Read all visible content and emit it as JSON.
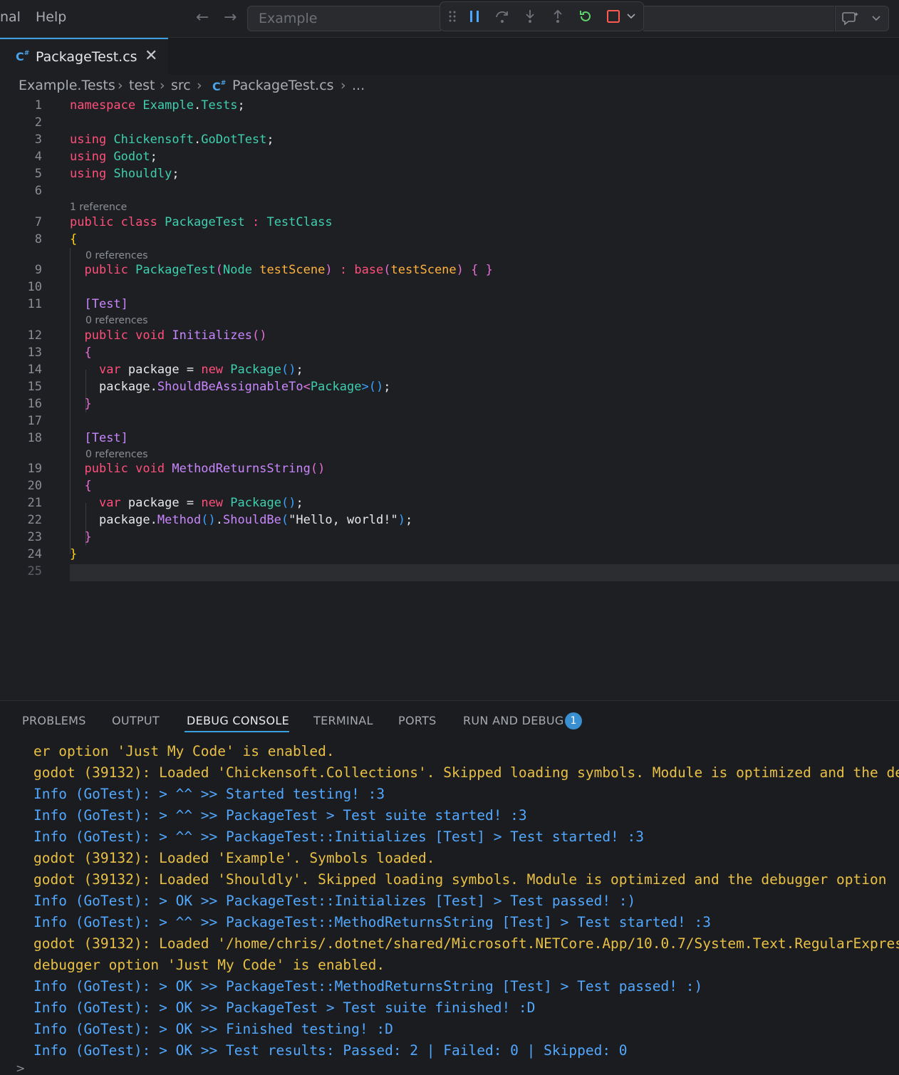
{
  "titlebar": {
    "menu_partial": "nal",
    "menu_help": "Help",
    "back": "←",
    "forward": "→",
    "command_center": "Example"
  },
  "tab": {
    "label": "PackageTest.cs",
    "close": "✕",
    "lang_icon": "C#"
  },
  "breadcrumb": [
    "Example.Tests",
    "test",
    "src",
    "PackageTest.cs",
    "..."
  ],
  "editor": {
    "line_numbers": [
      "1",
      "2",
      "3",
      "4",
      "5",
      "6",
      "7",
      "8",
      "9",
      "10",
      "11",
      "12",
      "13",
      "14",
      "15",
      "16",
      "17",
      "18",
      "19",
      "20",
      "21",
      "22",
      "23",
      "24",
      "25"
    ],
    "codelens": {
      "l7": "1 reference",
      "l9": "0 references",
      "l12": "0 references",
      "l19": "0 references"
    },
    "tokens": {
      "namespace": "namespace",
      "ns_example": "Example",
      "dot": ".",
      "ns_tests": "Tests",
      "semi": ";",
      "using": "using",
      "chickensoft": "Chickensoft",
      "godottest": "GoDotTest",
      "godot": "Godot",
      "shouldly": "Shouldly",
      "public": "public",
      "class": "class",
      "packagetest": "PackageTest",
      "colon": ":",
      "testclass": "TestClass",
      "lbrace": "{",
      "rbrace": "}",
      "lparen": "(",
      "rparen": ")",
      "node": "Node",
      "testscene": "testScene",
      "base": "base",
      "attr_test": "[Test]",
      "void": "void",
      "initializes": "Initializes",
      "parens": "()",
      "var": "var",
      "package": "package",
      "eq": "=",
      "new": "new",
      "package_type": "Package",
      "should_assignable": "ShouldBeAssignableTo",
      "lt": "<",
      "gt": ">",
      "method_returns_string": "MethodReturnsString",
      "method": "Method",
      "shouldbe": "ShouldBe",
      "hello": "\"Hello, world!\""
    }
  },
  "panel": {
    "tabs": [
      "PROBLEMS",
      "OUTPUT",
      "DEBUG CONSOLE",
      "TERMINAL",
      "PORTS",
      "RUN AND DEBUG"
    ],
    "active_tab": "DEBUG CONSOLE",
    "run_debug_badge": "1",
    "console_lines": [
      {
        "kind": "warn",
        "text": "er option 'Just My Code' is enabled."
      },
      {
        "kind": "warn",
        "text": "godot (39132): Loaded 'Chickensoft.Collections'. Skipped loading symbols. Module is optimized and the de"
      },
      {
        "kind": "info",
        "text": "Info (GoTest): > ^^ >> Started testing! :3"
      },
      {
        "kind": "info",
        "text": "Info (GoTest): > ^^ >> PackageTest > Test suite started! :3"
      },
      {
        "kind": "info",
        "text": "Info (GoTest): > ^^ >> PackageTest::Initializes [Test] > Test started! :3"
      },
      {
        "kind": "warn",
        "text": "godot (39132): Loaded 'Example'. Symbols loaded."
      },
      {
        "kind": "warn",
        "text": "godot (39132): Loaded 'Shouldly'. Skipped loading symbols. Module is optimized and the debugger option"
      },
      {
        "kind": "info",
        "text": "Info (GoTest): > OK >> PackageTest::Initializes [Test] > Test passed! :)"
      },
      {
        "kind": "info",
        "text": "Info (GoTest): > ^^ >> PackageTest::MethodReturnsString [Test] > Test started! :3"
      },
      {
        "kind": "warn",
        "text": "godot (39132): Loaded '/home/chris/.dotnet/shared/Microsoft.NETCore.App/10.0.7/System.Text.RegularExpres"
      },
      {
        "kind": "warn",
        "text": "debugger option 'Just My Code' is enabled."
      },
      {
        "kind": "info",
        "text": "Info (GoTest): > OK >> PackageTest::MethodReturnsString [Test] > Test passed! :)"
      },
      {
        "kind": "info",
        "text": "Info (GoTest): > OK >> PackageTest > Test suite finished! :D"
      },
      {
        "kind": "info",
        "text": "Info (GoTest): > OK >> Finished testing! :D"
      },
      {
        "kind": "info",
        "text": "Info (GoTest): > OK >> Test results: Passed: 2 | Failed: 0 | Skipped: 0"
      }
    ],
    "prompt": ">"
  },
  "colors": {
    "accent": "#3aa0e0",
    "info": "#52a8ff",
    "warn": "#e9c046",
    "keyword": "#ff4f7b",
    "type": "#3ecfb0"
  }
}
